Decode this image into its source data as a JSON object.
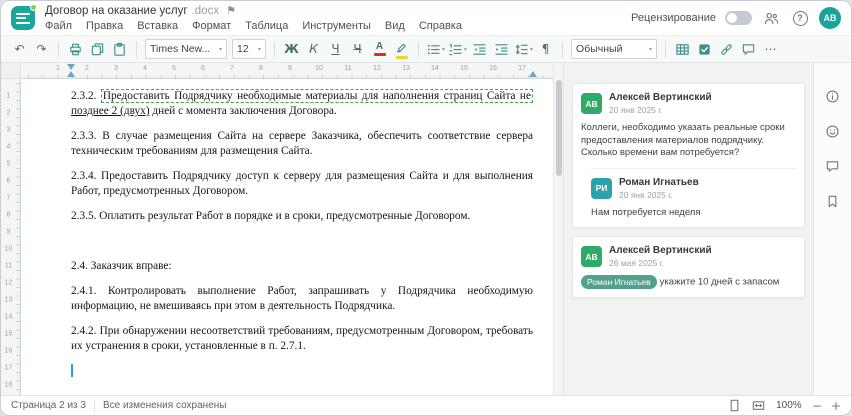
{
  "header": {
    "title": "Договор на оказание услуг",
    "title_ext": ".docx",
    "menu": [
      "Файл",
      "Правка",
      "Вставка",
      "Формат",
      "Таблица",
      "Инструменты",
      "Вид",
      "Справка"
    ],
    "review_label": "Рецензирование",
    "review_toggle_on": false,
    "avatar_initials": "АВ"
  },
  "icons": {
    "flag": "⚑",
    "help": "?",
    "caret": "▾",
    "zoom_out": "−",
    "zoom_in": "+"
  },
  "toolbar": {
    "items": [
      {
        "k": "icon",
        "n": "undo-icon",
        "g": "↶"
      },
      {
        "k": "icon",
        "n": "redo-icon",
        "g": "↷"
      },
      {
        "k": "sep"
      },
      {
        "k": "icon",
        "n": "print-icon"
      },
      {
        "k": "icon",
        "n": "copy-icon"
      },
      {
        "k": "icon",
        "n": "paste-icon"
      },
      {
        "k": "sep"
      },
      {
        "k": "combo",
        "n": "font-name-select",
        "v": "Times New...",
        "cls": "combo-font"
      },
      {
        "k": "combo",
        "n": "font-size-select",
        "v": "12",
        "cls": "combo-size"
      },
      {
        "k": "sep"
      },
      {
        "k": "icon",
        "n": "bold-button",
        "g": "Ж",
        "cls": "g-b"
      },
      {
        "k": "icon",
        "n": "italic-button",
        "g": "К",
        "cls": "g-i"
      },
      {
        "k": "icon",
        "n": "underline-button",
        "g": "Ч",
        "cls": "g-u"
      },
      {
        "k": "icon",
        "n": "strikethrough-button",
        "g": "Ч",
        "cls": "g-s"
      },
      {
        "k": "icon",
        "n": "font-color-button"
      },
      {
        "k": "icon",
        "n": "highlight-color-button"
      },
      {
        "k": "sep"
      },
      {
        "k": "icon",
        "n": "bullet-list-button",
        "caret": true
      },
      {
        "k": "icon",
        "n": "numbered-list-button",
        "caret": true
      },
      {
        "k": "icon",
        "n": "decrease-indent-button"
      },
      {
        "k": "icon",
        "n": "increase-indent-button"
      },
      {
        "k": "icon",
        "n": "line-spacing-button",
        "caret": true
      },
      {
        "k": "icon",
        "n": "paragraph-marks-button",
        "g": "¶"
      },
      {
        "k": "sep"
      },
      {
        "k": "combo",
        "n": "paragraph-style-select",
        "v": "Обычный",
        "cls": "combo-style"
      },
      {
        "k": "sep"
      },
      {
        "k": "icon",
        "n": "insert-table-button"
      },
      {
        "k": "icon",
        "n": "checkbox-button"
      },
      {
        "k": "icon",
        "n": "insert-link-button"
      },
      {
        "k": "icon",
        "n": "comment-button"
      },
      {
        "k": "icon",
        "n": "more-button",
        "g": "⋯"
      }
    ]
  },
  "ruler": {
    "h_numbers": [
      1,
      2,
      3,
      4,
      5,
      6,
      7,
      8,
      9,
      10,
      11,
      12,
      13,
      14,
      15,
      16,
      17
    ],
    "v_numbers": [
      1,
      2,
      3,
      4,
      5,
      6,
      7,
      8,
      9,
      10,
      11,
      12,
      13,
      14,
      15,
      16,
      17,
      18
    ]
  },
  "document": {
    "paragraphs": [
      {
        "runs": [
          {
            "t": "2.3.2. "
          },
          {
            "t": "Предоставить Подрядчику необходимые материалы для наполнения страниц Сайта не",
            "s": "comment"
          },
          {
            "t": " "
          },
          {
            "t": "позднее 2 (двух)",
            "s": "underline"
          },
          {
            "t": " дней с момента заключения Договора.",
            "s": ""
          }
        ]
      },
      {
        "runs": [
          {
            "t": "2.3.3. В случае размещения Сайта на сервере Заказчика, обеспечить соответствие сервера техническим требованиям для размещения Сайта."
          }
        ]
      },
      {
        "runs": [
          {
            "t": "2.3.4. Предоставить Подрядчику доступ к серверу для размещения Сайта и для выполнения Работ, предусмотренных Договором."
          }
        ]
      },
      {
        "runs": [
          {
            "t": "2.3.5. Оплатить результат Работ в порядке и в сроки, предусмотренные Договором."
          }
        ]
      },
      {
        "empty": true
      },
      {
        "runs": [
          {
            "t": "2.4. Заказчик вправе:"
          }
        ]
      },
      {
        "runs": [
          {
            "t": "2.4.1. Контролировать выполнение Работ, запрашивать у Подрядчика необходимую информацию, не вмешиваясь при этом в деятельность Подрядчика."
          }
        ]
      },
      {
        "runs": [
          {
            "t": "2.4.2. При обнаружении несоответствий требованиям, предусмотренным Договором, требовать их устранения в сроки, установленные в п. 2.7.1."
          }
        ]
      },
      {
        "cursor": true
      }
    ]
  },
  "comments": {
    "items": [
      {
        "initials": "АВ",
        "avatar_color": "#2fab69",
        "author": "Алексей Вертинский",
        "date": "20 янв 2025 г.",
        "text": "Коллеги, необходимо указать реальные сроки предоставления материалов подрядчику. Сколько времени вам потребуется?",
        "replies": [
          {
            "initials": "РИ",
            "avatar_color": "#2ba3ad",
            "author": "Роман Игнатьев",
            "date": "20 янв 2025 г.",
            "text": "Нам потребуется неделя"
          }
        ]
      },
      {
        "initials": "АВ",
        "avatar_color": "#2fab69",
        "author": "Алексей Вертинский",
        "date": "26 мая 2025 г.",
        "mention": "Роман Игнатьев",
        "text": "укажите 10 дней с запасом",
        "replies": []
      }
    ]
  },
  "right_rail": {
    "items": [
      "info-icon",
      "feedback-icon",
      "chat-icon",
      "bookmark-icon"
    ]
  },
  "statusbar": {
    "page_info": "Страница 2 из 3",
    "save_status": "Все изменения сохранены",
    "zoom": "100%"
  },
  "colors": {
    "accent": "#3d8e8a",
    "logo": "#1ba69b",
    "comment_highlight": "#3aa64c",
    "avatar_user": "#18a39b",
    "mention_chip": "#54a08e",
    "font_color_swatch": "#d93025",
    "highlight_swatch": "#f2d32b",
    "caret": "#2f9ae0"
  }
}
